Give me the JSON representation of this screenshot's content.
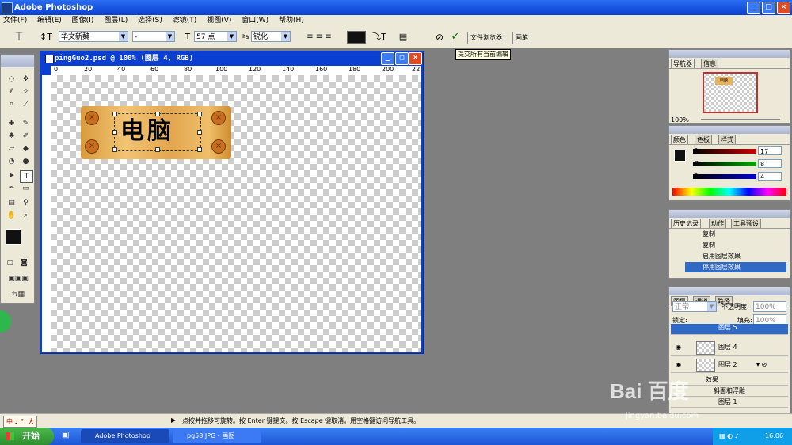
{
  "app": {
    "title": "Adobe Photoshop"
  },
  "menu": [
    "文件(F)",
    "编辑(E)",
    "图像(I)",
    "图层(L)",
    "选择(S)",
    "滤镜(T)",
    "视图(V)",
    "窗口(W)",
    "帮助(H)"
  ],
  "options": {
    "font_family": "华文新魏",
    "font_style": "-",
    "font_size": "57 点",
    "antialias": "锐化",
    "tooltip": "提交所有当前编辑",
    "palette_tabs": [
      "文件浏览器",
      "画笔"
    ]
  },
  "document": {
    "title": "pingGuo2.psd @ 100% (图层 4, RGB)",
    "ruler_labels": [
      "0",
      "20",
      "40",
      "60",
      "80",
      "100",
      "120",
      "140",
      "160",
      "180",
      "200",
      "22"
    ],
    "text": "电脑"
  },
  "navigator": {
    "tabs": [
      "导航器",
      "信息"
    ],
    "zoom": "100%",
    "preview_text": "电脑"
  },
  "color": {
    "tabs": [
      "颜色",
      "色板",
      "样式"
    ],
    "channels": [
      {
        "label": "R",
        "value": "17"
      },
      {
        "label": "G",
        "value": "8"
      },
      {
        "label": "B",
        "value": "4"
      }
    ]
  },
  "history": {
    "tabs": [
      "历史记录",
      "动作",
      "工具预设"
    ],
    "items": [
      "复制",
      "复制",
      "启用图层效果",
      "停用图层效果"
    ]
  },
  "layers": {
    "tabs": [
      "图层",
      "通道",
      "路径"
    ],
    "blend_mode": "正常",
    "opacity_label": "不透明度:",
    "opacity": "100%",
    "lock_label": "锁定:",
    "fill_label": "填充:",
    "fill": "100%",
    "rows": [
      "图层 5",
      "图层 4",
      "图层 2",
      "效果",
      "斜面和浮雕",
      "图层 1"
    ]
  },
  "status": {
    "ime": "中 ♪ °, 大",
    "message": "点按并拖移可旋转。按 Enter 键提交。按 Escape 键取消。用空格键访问导航工具。"
  },
  "taskbar": {
    "start": "开始",
    "tasks": [
      "Adobe Photoshop",
      "pg58.JPG - 画图"
    ],
    "clock": "16:06"
  },
  "watermark": {
    "brand": "Bai 百度",
    "url": "jingyan.baidu.com"
  },
  "colors": {
    "titlebar": "#0a3fd1",
    "workspace": "#7f7f7f",
    "selected": "#316ac5"
  }
}
